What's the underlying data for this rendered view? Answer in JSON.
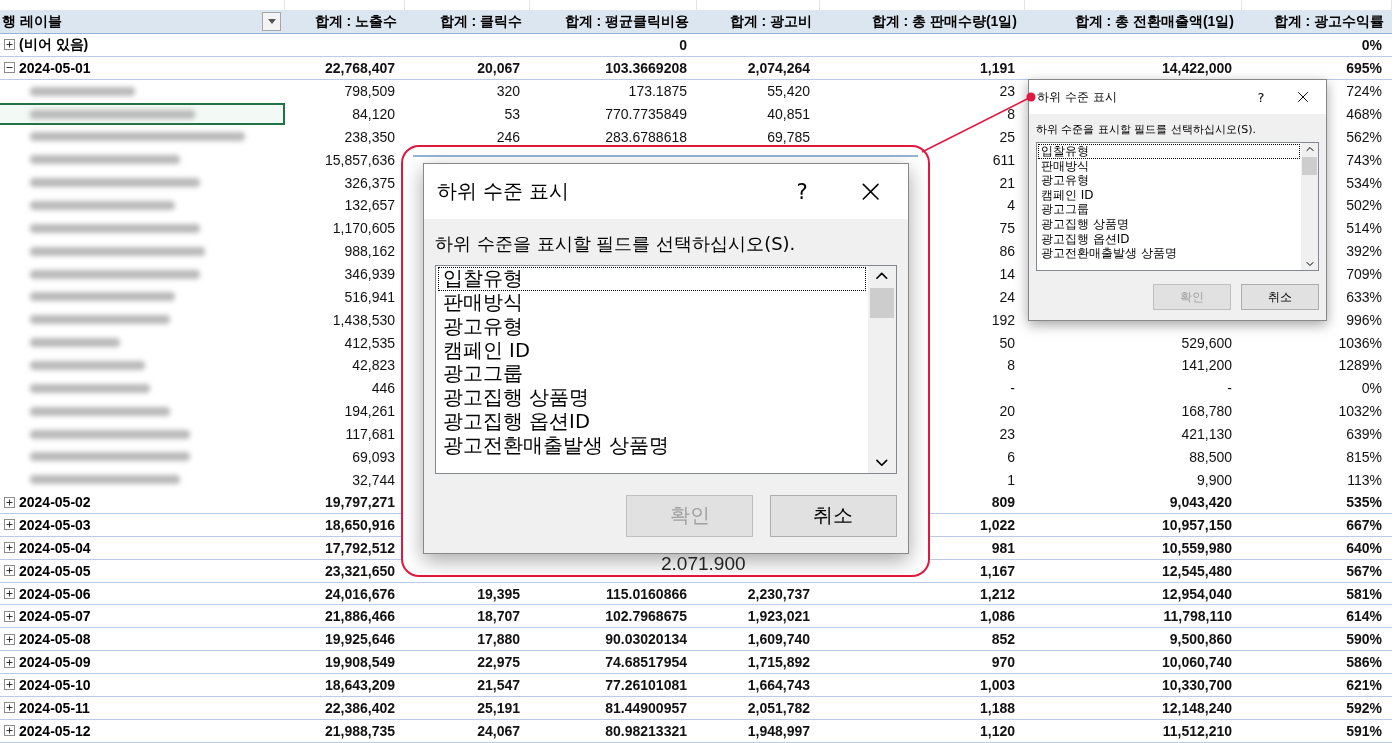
{
  "table": {
    "columns": [
      "행 레이블",
      "합계 : 노출수",
      "합계 : 클릭수",
      "합계 : 평균클릭비용",
      "합계 : 광고비",
      "합계 : 총 판매수량(1일)",
      "합계 : 총 전환매출액(1일)",
      "합계 : 광고수익률"
    ],
    "rows": [
      {
        "kind": "group",
        "expanded": false,
        "cells": [
          "(비어 있음)",
          null,
          null,
          "0",
          null,
          null,
          null,
          "0%"
        ]
      },
      {
        "kind": "group",
        "expanded": true,
        "cells": [
          "2024-05-01",
          "22,768,407",
          "20,067",
          "103.3669208",
          "2,074,264",
          "1,191",
          "14,422,000",
          "695%"
        ]
      },
      {
        "kind": "detail",
        "selected": false,
        "cells": [
          null,
          "798,509",
          "320",
          "173.1875",
          "55,420",
          "23",
          null,
          "724%"
        ]
      },
      {
        "kind": "detail",
        "selected": true,
        "cells": [
          null,
          "84,120",
          "53",
          "770.7735849",
          "40,851",
          "8",
          null,
          "468%"
        ]
      },
      {
        "kind": "detail",
        "selected": false,
        "cells": [
          null,
          "238,350",
          "246",
          "283.6788618",
          "69,785",
          "25",
          null,
          "562%"
        ]
      },
      {
        "kind": "detail",
        "selected": false,
        "cells": [
          null,
          "15,857,636",
          null,
          null,
          null,
          "611",
          null,
          "743%"
        ]
      },
      {
        "kind": "detail",
        "selected": false,
        "cells": [
          null,
          "326,375",
          null,
          null,
          null,
          "21",
          null,
          "534%"
        ]
      },
      {
        "kind": "detail",
        "selected": false,
        "cells": [
          null,
          "132,657",
          null,
          null,
          null,
          "4",
          null,
          "502%"
        ]
      },
      {
        "kind": "detail",
        "selected": false,
        "cells": [
          null,
          "1,170,605",
          null,
          null,
          null,
          "75",
          null,
          "514%"
        ]
      },
      {
        "kind": "detail",
        "selected": false,
        "cells": [
          null,
          "988,162",
          null,
          null,
          null,
          "86",
          null,
          "392%"
        ]
      },
      {
        "kind": "detail",
        "selected": false,
        "cells": [
          null,
          "346,939",
          null,
          null,
          null,
          "14",
          null,
          "709%"
        ]
      },
      {
        "kind": "detail",
        "selected": false,
        "cells": [
          null,
          "516,941",
          null,
          null,
          null,
          "24",
          null,
          "633%"
        ]
      },
      {
        "kind": "detail",
        "selected": false,
        "cells": [
          null,
          "1,438,530",
          null,
          null,
          null,
          "192",
          null,
          "996%"
        ]
      },
      {
        "kind": "detail",
        "selected": false,
        "cells": [
          null,
          "412,535",
          null,
          null,
          null,
          "50",
          "529,600",
          "1036%"
        ]
      },
      {
        "kind": "detail",
        "selected": false,
        "cells": [
          null,
          "42,823",
          null,
          null,
          null,
          "8",
          "141,200",
          "1289%"
        ]
      },
      {
        "kind": "detail",
        "selected": false,
        "cells": [
          null,
          "446",
          null,
          null,
          null,
          "-",
          "-",
          "0%"
        ]
      },
      {
        "kind": "detail",
        "selected": false,
        "cells": [
          null,
          "194,261",
          null,
          null,
          null,
          "20",
          "168,780",
          "1032%"
        ]
      },
      {
        "kind": "detail",
        "selected": false,
        "cells": [
          null,
          "117,681",
          null,
          null,
          null,
          "23",
          "421,130",
          "639%"
        ]
      },
      {
        "kind": "detail",
        "selected": false,
        "cells": [
          null,
          "69,093",
          null,
          null,
          null,
          "6",
          "88,500",
          "815%"
        ]
      },
      {
        "kind": "detail",
        "selected": false,
        "cells": [
          null,
          "32,744",
          null,
          null,
          null,
          "1",
          "9,900",
          "113%"
        ]
      },
      {
        "kind": "group",
        "expanded": false,
        "cells": [
          "2024-05-02",
          "19,797,271",
          null,
          null,
          null,
          "809",
          "9,043,420",
          "535%"
        ]
      },
      {
        "kind": "group",
        "expanded": false,
        "cells": [
          "2024-05-03",
          "18,650,916",
          null,
          null,
          null,
          "1,022",
          "10,957,150",
          "667%"
        ]
      },
      {
        "kind": "group",
        "expanded": false,
        "cells": [
          "2024-05-04",
          "17,792,512",
          null,
          null,
          null,
          "981",
          "10,559,980",
          "640%"
        ]
      },
      {
        "kind": "group",
        "expanded": false,
        "cells": [
          "2024-05-05",
          "23,321,650",
          null,
          null,
          null,
          "1,167",
          "12,545,480",
          "567%"
        ]
      },
      {
        "kind": "group",
        "expanded": false,
        "cells": [
          "2024-05-06",
          "24,016,676",
          "19,395",
          "115.0160866",
          "2,230,737",
          "1,212",
          "12,954,040",
          "581%"
        ]
      },
      {
        "kind": "group",
        "expanded": false,
        "cells": [
          "2024-05-07",
          "21,886,466",
          "18,707",
          "102.7968675",
          "1,923,021",
          "1,086",
          "11,798,110",
          "614%"
        ]
      },
      {
        "kind": "group",
        "expanded": false,
        "cells": [
          "2024-05-08",
          "19,925,646",
          "17,880",
          "90.03020134",
          "1,609,740",
          "852",
          "9,500,860",
          "590%"
        ]
      },
      {
        "kind": "group",
        "expanded": false,
        "cells": [
          "2024-05-09",
          "19,908,549",
          "22,975",
          "74.68517954",
          "1,715,892",
          "970",
          "10,060,740",
          "586%"
        ]
      },
      {
        "kind": "group",
        "expanded": false,
        "cells": [
          "2024-05-10",
          "18,643,209",
          "21,547",
          "77.26101081",
          "1,664,743",
          "1,003",
          "10,330,700",
          "621%"
        ]
      },
      {
        "kind": "group",
        "expanded": false,
        "cells": [
          "2024-05-11",
          "22,386,402",
          "25,191",
          "81.44900957",
          "2,051,782",
          "1,188",
          "12,148,240",
          "592%"
        ]
      },
      {
        "kind": "group",
        "expanded": false,
        "cells": [
          "2024-05-12",
          "21,988,735",
          "24,067",
          "80.98213321",
          "1,948,997",
          "1,120",
          "11,512,210",
          "591%"
        ]
      }
    ]
  },
  "dialog": {
    "title": "하위 수준 표시",
    "help": "?",
    "instruction": "하위 수준을 표시할 필드를 선택하십시오(S).",
    "items": [
      {
        "label": "입찰유형",
        "focused": true
      },
      {
        "label": "판매방식",
        "focused": false
      },
      {
        "label": "광고유형",
        "focused": false
      },
      {
        "label": "캠페인 ID",
        "focused": false
      },
      {
        "label": "광고그룹",
        "focused": false
      },
      {
        "label": "광고집행 상품명",
        "focused": false
      },
      {
        "label": "광고집행 옵션ID",
        "focused": false
      },
      {
        "label": "광고전환매출발생 상품명",
        "focused": false
      }
    ],
    "buttons": [
      {
        "label": "확인",
        "disabled": true
      },
      {
        "label": "취소",
        "disabled": false
      }
    ]
  },
  "callout": {
    "fragment": "2.071.900",
    "dialog": {
      "title": "하위 수준 표시",
      "help": "?",
      "instruction": "하위 수준을 표시할 필드를 선택하십시오(S).",
      "items": [
        {
          "label": "입찰유형",
          "focused": true
        },
        {
          "label": "판매방식",
          "focused": false
        },
        {
          "label": "광고유형",
          "focused": false
        },
        {
          "label": "캠페인 ID",
          "focused": false
        },
        {
          "label": "광고그룹",
          "focused": false
        },
        {
          "label": "광고집행 상품명",
          "focused": false
        },
        {
          "label": "광고집행 옵션ID",
          "focused": false
        },
        {
          "label": "광고전환매출발생 상품명",
          "focused": false
        }
      ],
      "buttons": [
        {
          "label": "확인",
          "disabled": true
        },
        {
          "label": "취소",
          "disabled": false
        }
      ]
    }
  }
}
